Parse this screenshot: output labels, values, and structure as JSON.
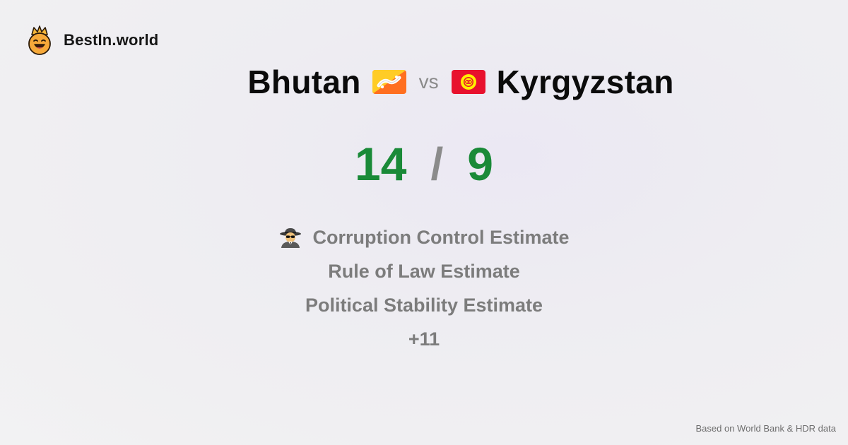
{
  "brand": {
    "name": "BestIn.world",
    "logo_icon": "crown-smiley-icon"
  },
  "comparison": {
    "left_country": "Bhutan",
    "left_flag": "bhutan-flag-icon",
    "vs_label": "vs",
    "right_country": "Kyrgyzstan",
    "right_flag": "kyrgyzstan-flag-icon"
  },
  "score": {
    "left": "14",
    "separator": "/",
    "right": "9",
    "color": "#1a8a38"
  },
  "metrics": {
    "items": [
      {
        "label": "Corruption Control Estimate",
        "icon": "spy-detective-icon"
      },
      {
        "label": "Rule of Law Estimate"
      },
      {
        "label": "Political Stability Estimate"
      },
      {
        "label": "+11"
      }
    ]
  },
  "footer": {
    "source": "Based on World Bank & HDR data"
  },
  "colors": {
    "text_primary": "#0b0b0b",
    "text_muted": "#7c7c7c",
    "score_green": "#1a8a38"
  }
}
